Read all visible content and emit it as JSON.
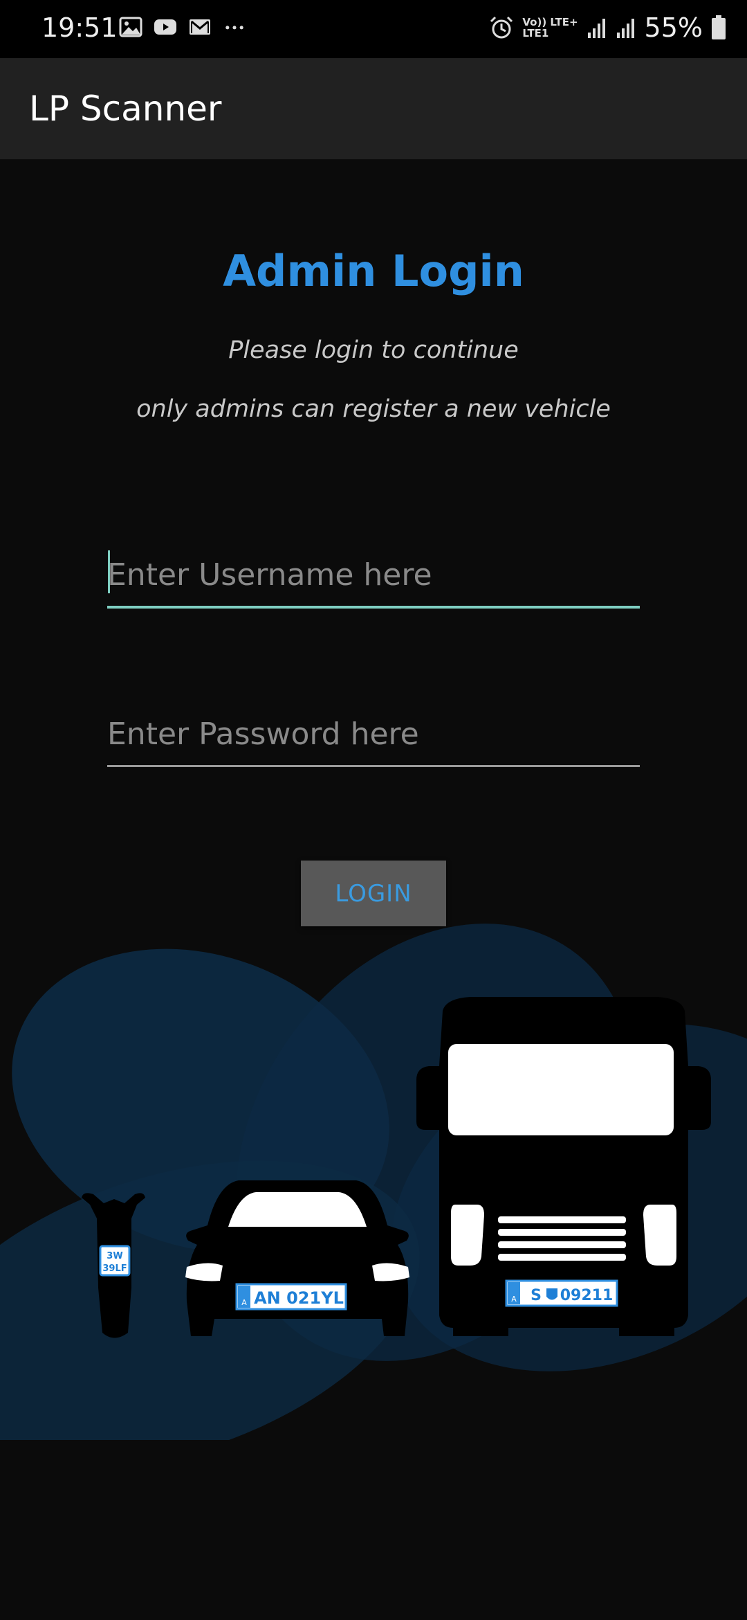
{
  "status_bar": {
    "time": "19:51",
    "icons": [
      "image-icon",
      "youtube-icon",
      "gmail-icon",
      "more-icon"
    ],
    "network_top": "Vo)) LTE+",
    "network_bottom": "LTE1",
    "battery": "55%"
  },
  "app_bar": {
    "title": "LP Scanner"
  },
  "login": {
    "heading": "Admin Login",
    "subtitle1": "Please login to continue",
    "subtitle2": "only admins can register a new vehicle",
    "username_placeholder": "Enter Username here",
    "password_placeholder": "Enter Password here",
    "button_label": "LOGIN"
  },
  "plates": {
    "moto_line1": "3W",
    "moto_line2": "39LF",
    "car": "AN 021YL",
    "truck_prefix": "S",
    "truck_number": "09211",
    "country_code": "A"
  },
  "colors": {
    "accent": "#2f8fe0",
    "underline_focus": "#7fcfc2",
    "background": "#0b0b0b",
    "app_bar": "#212121"
  }
}
